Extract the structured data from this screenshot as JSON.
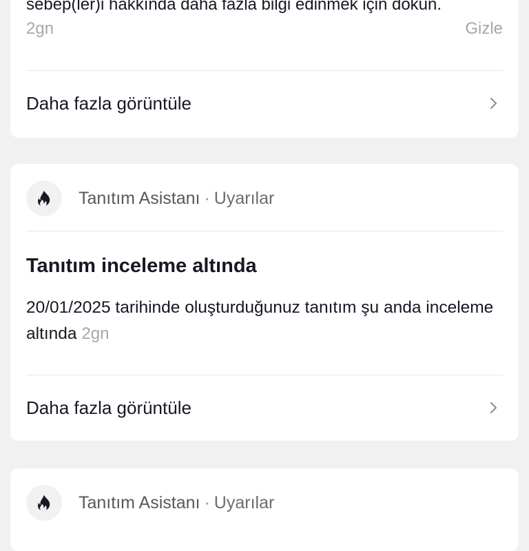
{
  "previous_notification": {
    "body_text": "sebep(ler)i hakkında daha fazla bilgi edinmek için dokun.",
    "time": "2gn",
    "hide_label": "Gizle",
    "more_label": "Daha fazla görüntüle"
  },
  "notification": {
    "sender_name": "Tanıtım Asistanı",
    "separator": "·",
    "category": "Uyarılar",
    "icon": "flame-icon",
    "title": "Tanıtım inceleme altında",
    "body_text": "20/01/2025 tarihinde oluşturduğunuz tanıtım şu anda inceleme altında",
    "time": "2gn",
    "more_label": "Daha fazla görüntüle"
  },
  "next_notification": {
    "sender_name": "Tanıtım Asistanı",
    "separator": "·",
    "category": "Uyarılar",
    "icon": "flame-icon"
  },
  "colors": {
    "background": "#f1f1f2",
    "card": "#ffffff",
    "text_primary": "#161823",
    "text_secondary": "#a7a7ab"
  }
}
